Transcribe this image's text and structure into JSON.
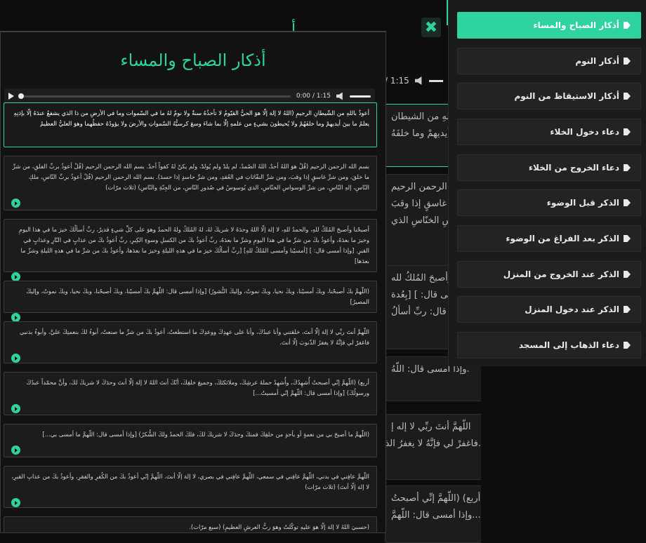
{
  "background": {
    "audio_time": "/ 1:15",
    "cards": [
      "أعوذُ باللهِ من الشيطان",
      "ينَ أيديهمْ وما خلفَهُ",
      "الله الرحمن الرحيم",
      "شرِّ غاسقٍ إذا وقبَ",
      "واسِ الخنّاسِ الذي",
      "نا وأصبحَ المُلكُ لله",
      "أمسى قال: ] [بِعُدة",
      "أمسى قال: ربِّ أسألُ",
      ".وإذا أمسى قال: اللّهُ",
      "اللّهمَّ أنتَ ربِّي لا إله إ",
      ".فاغفرْ لي فإنَّهُ لا يغفرُ الذ",
      "أربع) (اللّهمَّ إنِّي أصبحتُ",
      "...وإذا أمسى قال: اللّهمَّ"
    ]
  },
  "close_icon": "close-icon",
  "modal": {
    "title": "أذكار الصباح والمساء",
    "player": {
      "time": "0:00 / 1:15"
    },
    "cards": [
      "أعوذُ باللهِ من الشّيطانِ الرجيمِ (اللهُ لا إلهَ إلّا هوَ الحيُّ القيّومُ لا تأخذُهُ سنةٌ ولا نومٌ لهُ ما في السّموات وما في الأرضِ من ذا الذي يشفعُ عندَهُ إلّا بإذنِهِ يعلمُ ما بينَ أيديهمْ وما خلفَهُمْ ولا يُحيطونَ بشيءٍ من علمهِ إلّا بما شاءَ وسعَ كرسيُّهُ السّمواتِ والأرضَ ولا يؤودُهُ حفظُهما وهوَ العليُّ العظيمُ",
      "بسم الله الرحمن الرحيم (قُلْ هوَ اللهُ أحدٌ، اللهُ الصّمدُ، لم يلدْ ولم يُولدْ، ولم يكنْ لهُ كفواً أحدٌ. بسم الله الرحمن الرحيم (قُلْ أعوذُ بربِّ الفلقِ، من شرِّ ما خلقَ، ومن شرِّ غاسقٍ إذا وقبَ، ومن شرِّ النفّاثاتِ في العُقدِ، ومن شرِّ حاسدٍ إذا حسدَ). بسم الله الرحمن الرحيم (قُلْ أعوذُ بربِّ النّاسِ، ملكِ النّاسِ، إلهِ النّاسِ، من شرِّ الوسواسِ الخنّاسِ، الذي يُوسوسُ في صُدورِ النّاسِ، من الجِنّةِ والنّاسِ) (ثلاث مرّات)",
      "أصبحْنا وأصبحَ المُلكُ للهِ، والحمدُ للهِ، لا إلهَ إلّا اللهُ وحدَهُ لا شريكَ لهُ، لهُ المُلكُ ولهُ الحمدُ وهوَ على كلِّ شيءٍ قديرٌ، ربِّ أسألُكَ خيرَ ما في هذا اليومِ وخيرَ ما بعدَهُ، وأعوذُ بكَ من شرِّ ما في هذا اليومِ وشرِّ ما بعدَهُ، ربِّ أعوذُ بكَ من الكسلِ وسوءِ الكِبرِ، ربِّ أعوذُ بكَ من عذابٍ في النّارِ وعذابٍ في القبرِ. [وإذا أمسى قال: ] [أمسيْنا وأمسى المُلكُ للهِ] [ربِّ أسألُكَ خيرَ ما في هذهِ الليلةِ وخيرَ ما بعدَها، وأعوذُ بكَ من شرِّ ما في هذهِ الليلةِ وشرِّ ما بعدَها]",
      "(اللّهمَّ بكَ أصبحْنا، وبكَ أمسيْنا، وبكَ نحيا، وبكَ نموتُ، وإليكَ النُّشورُ) [وإذا أمسى قال: اللّهمَّ بكَ أمسيْنا، وبكَ أصبحْنا، وبكَ نحيا، وبكَ نموتُ، وإليكَ المصيرُ]",
      "اللّهمَّ أنتَ ربِّي لا إلهَ إلّا أنتَ، خلقتني وأنا عبدُكَ، وأنا على عهدِكَ ووعدِكَ ما استطعتُ، أعوذُ بكَ من شرِّ ما صنعتُ، أبوءُ لكَ بنعمتِكَ عليَّ، وأبوءُ بذنبي فاغفرْ لي فإنَّهُ لا يغفرُ الذّنوبَ إلّا أنتَ.",
      "أربع) (اللّهمَّ إنّي أصبحتُ أُشهِدُكَ، وأُشهِدُ حملةَ عرشِكَ، وملائكتَكَ، وجميعَ خلقِكَ، أنّكَ أنتَ اللهُ لا إلهَ إلّا أنتَ وحدَكَ لا شريكَ لكَ، وأنَّ محمّداً عبدُكَ ورسولُكَ) [وإذا أمسى قال: اللّهمَّ إنّي أمسيتُ...]",
      "(اللّهمَّ ما أصبحَ بي من نعمةٍ أو بأحدٍ من خلقِكَ فمنكَ وحدَكَ لا شريكَ لكَ، فلكَ الحمدُ ولكَ الشُّكرُ) [وإذا أمسى قال: اللّهمَّ ما أمسى بي...]",
      "اللّهمَّ عافِني في بدني، اللّهمَّ عافِني في سمعي، اللّهمَّ عافِني في بصري، لا إلهَ إلّا أنتَ. اللّهمَّ إنّي أعوذُ بكَ من الكُفرِ والفقرِ، وأعوذُ بكَ من عذابِ القبرِ، لا إلهَ إلّا أنتَ) (ثلاث مرّات)",
      "(حسبيَ اللهُ لا إلهَ إلّا هوَ عليهِ توكّلتُ وهوَ ربُّ العرشِ العظيمِ) (سبع مرّات)."
    ]
  },
  "menu": {
    "items": [
      "أذكار الصباح والمساء",
      "أذكار النوم",
      "أذكار الاستيقاظ من النوم",
      "دعاء دخول الخلاء",
      "دعاء الخروج من الخلاء",
      "الذكر قبل الوضوء",
      "الذكر بعد الفراغ من الوضوء",
      "الذكر عند الخروج من المنزل",
      "الذكر عند دخول المنزل",
      "دعاء الذهاب إلى المسجد"
    ],
    "active_index": 0,
    "icon": "tag-icon"
  },
  "colors": {
    "accent": "#2ed3a0",
    "background": "#0e0e0e",
    "card": "#1c1c1c"
  }
}
